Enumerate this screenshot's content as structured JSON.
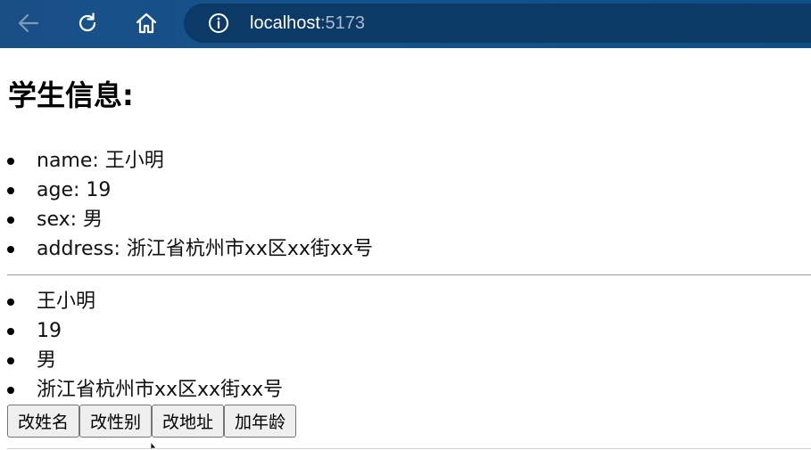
{
  "browser": {
    "url_host": "localhost",
    "url_port": ":5173",
    "icons": {
      "back": "back-arrow-icon",
      "reload": "reload-icon",
      "home": "home-icon",
      "info": "info-icon"
    },
    "colors": {
      "toolbar": "#14528c",
      "address_bar": "#0b3a66"
    }
  },
  "page": {
    "title": "学生信息:",
    "student_fields": [
      {
        "key": "name",
        "separator": ": ",
        "value": "王小明"
      },
      {
        "key": "age",
        "separator": ": ",
        "value": "19"
      },
      {
        "key": "sex",
        "separator": ": ",
        "value": "男"
      },
      {
        "key": "address",
        "separator": ": ",
        "value": "浙江省杭州市xx区xx街xx号"
      }
    ],
    "values_list": [
      "王小明",
      "19",
      "男",
      "浙江省杭州市xx区xx街xx号"
    ],
    "buttons": {
      "change_name": "改姓名",
      "change_sex": "改性别",
      "change_address": "改地址",
      "add_age": "加年龄"
    }
  }
}
